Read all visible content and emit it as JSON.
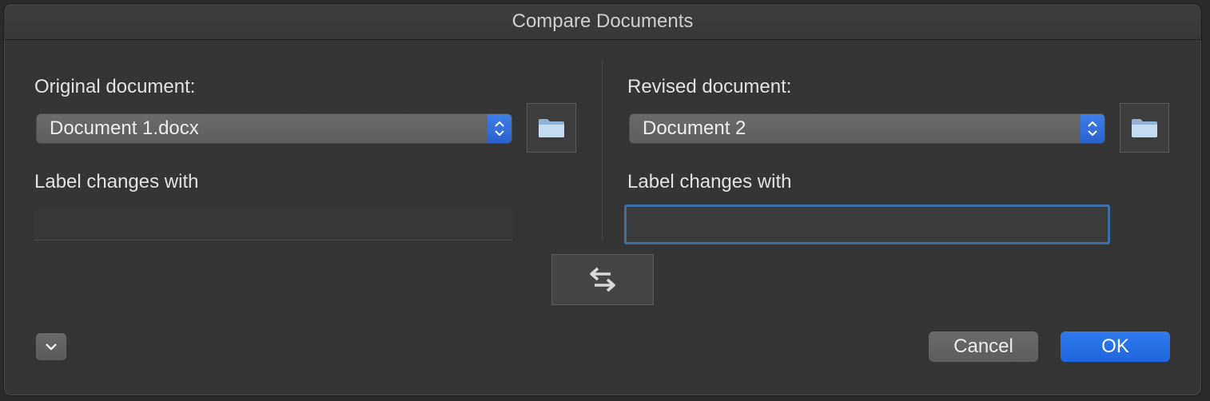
{
  "window": {
    "title": "Compare Documents"
  },
  "original": {
    "label": "Original document:",
    "selected": "Document 1.docx",
    "label_changes_label": "Label changes with",
    "label_changes_value": "",
    "folder_icon": "folder-icon"
  },
  "revised": {
    "label": "Revised document:",
    "selected": "Document 2",
    "label_changes_label": "Label changes with",
    "label_changes_value": "",
    "folder_icon": "folder-icon"
  },
  "swap": {
    "icon": "swap-arrows-icon"
  },
  "footer": {
    "disclosure_icon": "chevron-down-icon",
    "cancel_label": "Cancel",
    "ok_label": "OK"
  },
  "colors": {
    "accent": "#2f7af0",
    "focus_ring": "#3a6fa8",
    "background": "#353535"
  }
}
